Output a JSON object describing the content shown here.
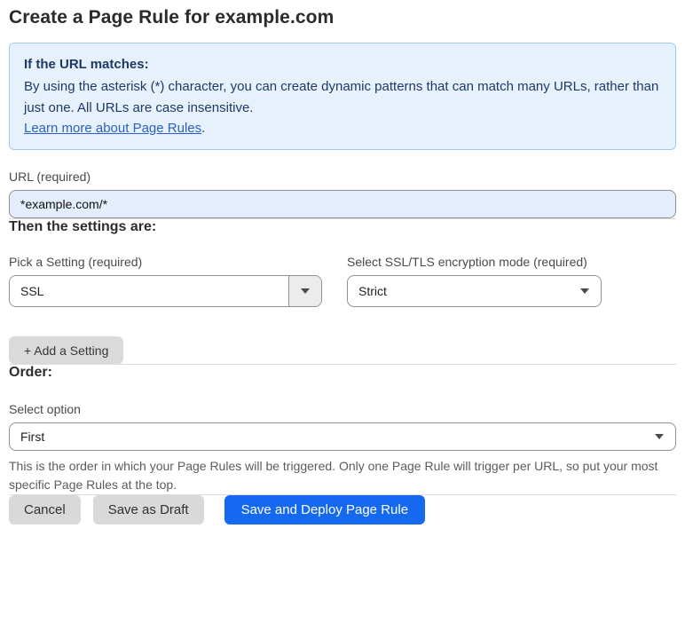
{
  "page": {
    "title": "Create a Page Rule for example.com"
  },
  "info_box": {
    "heading": "If the URL matches:",
    "body": "By using the asterisk (*) character, you can create dynamic patterns that can match many URLs, rather than just one. All URLs are case insensitive.",
    "link_label": "Learn more about Page Rules",
    "link_suffix": "."
  },
  "url_field": {
    "label": "URL (required)",
    "value": "*example.com/*"
  },
  "settings_section": {
    "heading": "Then the settings are:",
    "setting_select": {
      "label": "Pick a Setting (required)",
      "value": "SSL"
    },
    "mode_select": {
      "label": "Select SSL/TLS encryption mode (required)",
      "value": "Strict"
    },
    "add_setting_label": "+ Add a Setting"
  },
  "order_section": {
    "heading": "Order:",
    "select_label": "Select option",
    "value": "First",
    "help_text": "This is the order in which your Page Rules will be triggered. Only one Page Rule will trigger per URL, so put your most specific Page Rules at the top."
  },
  "actions": {
    "cancel_label": "Cancel",
    "save_draft_label": "Save as Draft",
    "save_deploy_label": "Save and Deploy Page Rule"
  },
  "colors": {
    "primary_blue": "#1569f0",
    "info_background": "#e7f1fb",
    "info_border": "#a6c9ee",
    "info_text": "#1d3a66",
    "link_blue": "#2b5fc7",
    "input_background": "#e3edfb"
  }
}
